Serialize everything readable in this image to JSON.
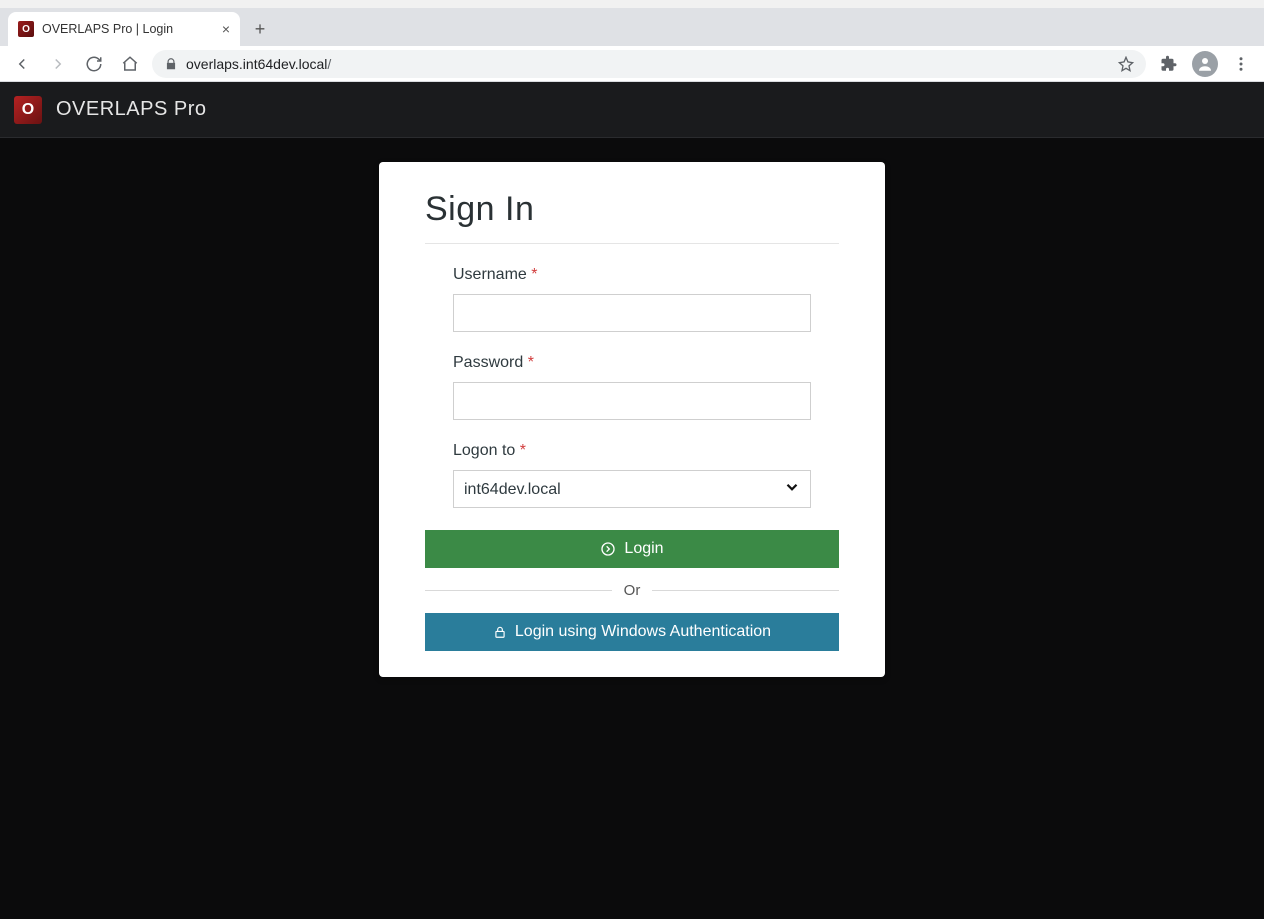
{
  "window": {
    "tab_title": "OVERLAPS Pro | Login",
    "url_host": "overlaps.int64dev.local",
    "url_path": "/"
  },
  "app": {
    "brand": "OVERLAPS Pro"
  },
  "form": {
    "heading": "Sign In",
    "username_label": "Username",
    "password_label": "Password",
    "logon_label": "Logon to",
    "required_mark": "*",
    "domain_value": "int64dev.local",
    "login_label": "Login",
    "or_label": "Or",
    "winauth_label": "Login using Windows Authentication"
  }
}
